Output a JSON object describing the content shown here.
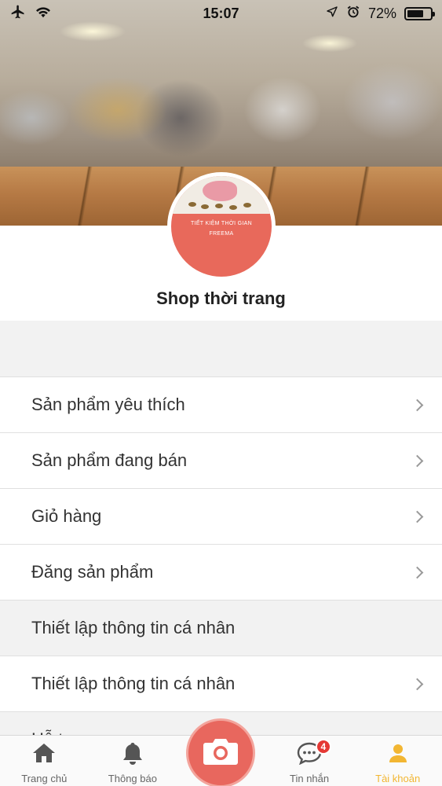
{
  "status_bar": {
    "time": "15:07",
    "battery_percent_label": "72%",
    "battery_level": 0.72,
    "icons": [
      "airplane-icon",
      "wifi-icon",
      "location-icon",
      "alarm-icon",
      "battery-icon"
    ]
  },
  "profile": {
    "avatar_title_line1": "TIẾT KIỆM THỜI GIAN",
    "avatar_title_line2": "FREEMA",
    "shop_name": "Shop thời trang"
  },
  "menu": {
    "items": [
      {
        "label": "Sản phẩm yêu thích",
        "type": "link"
      },
      {
        "label": "Sản phẩm đang bán",
        "type": "link"
      },
      {
        "label": "Giỏ hàng",
        "type": "link"
      },
      {
        "label": "Đăng sản phẩm",
        "type": "link"
      },
      {
        "label": "Thiết lập thông tin cá nhân",
        "type": "section"
      },
      {
        "label": "Thiết lập thông tin cá nhân",
        "type": "link"
      },
      {
        "label": "Hỗ trợ",
        "type": "section"
      }
    ]
  },
  "tab_bar": {
    "tabs": [
      {
        "label": "Trang chủ",
        "icon": "home-icon",
        "active": false
      },
      {
        "label": "Thông báo",
        "icon": "bell-icon",
        "active": false
      },
      {
        "label": "",
        "icon": "camera-icon",
        "active": false
      },
      {
        "label": "Tin nhắn",
        "icon": "chat-icon",
        "active": false,
        "badge": "4"
      },
      {
        "label": "Tài khoản",
        "icon": "user-icon",
        "active": true
      }
    ],
    "active_color": "#f2b632",
    "camera_color": "#e8675e"
  }
}
